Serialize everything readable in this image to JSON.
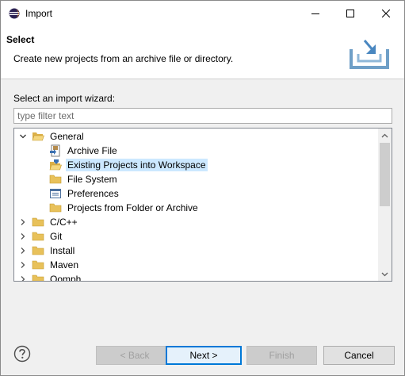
{
  "window": {
    "title": "Import",
    "minimize_glyph": "—",
    "maximize_glyph": "☐",
    "close_glyph": "✕"
  },
  "header": {
    "title": "Select",
    "description": "Create new projects from an archive file or directory.",
    "graphic_icon": "import-wizard-graphic"
  },
  "wizard": {
    "label": "Select an import wizard:",
    "filter_placeholder": "type filter text",
    "filter_value": ""
  },
  "tree": {
    "items": [
      {
        "label": "General",
        "expanded": true,
        "level": 0,
        "icon": "folder-open-icon"
      },
      {
        "label": "Archive File",
        "level": 1,
        "icon": "archive-file-icon"
      },
      {
        "label": "Existing Projects into Workspace",
        "level": 1,
        "icon": "existing-projects-icon",
        "selected": true
      },
      {
        "label": "File System",
        "level": 1,
        "icon": "folder-icon"
      },
      {
        "label": "Preferences",
        "level": 1,
        "icon": "preferences-icon"
      },
      {
        "label": "Projects from Folder or Archive",
        "level": 1,
        "icon": "folder-icon"
      },
      {
        "label": "C/C++",
        "expanded": false,
        "level": 0,
        "icon": "folder-icon"
      },
      {
        "label": "Git",
        "expanded": false,
        "level": 0,
        "icon": "folder-icon"
      },
      {
        "label": "Install",
        "expanded": false,
        "level": 0,
        "icon": "folder-icon"
      },
      {
        "label": "Maven",
        "expanded": false,
        "level": 0,
        "icon": "folder-icon"
      },
      {
        "label": "Oomph",
        "expanded": false,
        "level": 0,
        "icon": "folder-icon"
      }
    ]
  },
  "buttons": {
    "back": "< Back",
    "next": "Next >",
    "finish": "Finish",
    "cancel": "Cancel"
  },
  "colors": {
    "selection": "#cce8ff",
    "default_button_border": "#0078d7",
    "folder": "#e8c15a"
  }
}
